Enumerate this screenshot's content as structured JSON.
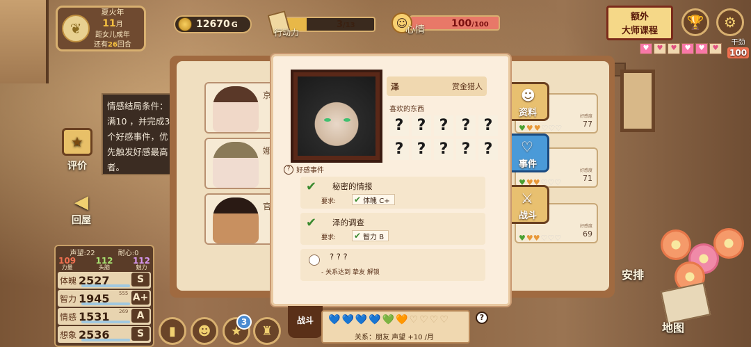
{
  "date": {
    "season": "夏火年",
    "month_num": "11",
    "month_unit": "月",
    "countdown_prefix": "距女儿成年",
    "countdown_mid": "还有",
    "countdown_turns": "26",
    "countdown_suffix": "回合"
  },
  "gold": {
    "value": "12670",
    "unit": "G"
  },
  "action_points": {
    "label": "行动力",
    "current": "3",
    "max": "/13",
    "fraction": 0.23
  },
  "mood": {
    "label": "心情",
    "current": "100",
    "max": "/100"
  },
  "course_button": {
    "line1": "额外",
    "line2": "大师课程"
  },
  "top_hearts": [
    "♥",
    "♥",
    "♥",
    "♥",
    "♥",
    "♥"
  ],
  "dry": {
    "label": "干劲",
    "value": "100"
  },
  "tooltip": {
    "text": "情感结局条件：满10  ，并完成3个好感事件，优先触发好感最高者。"
  },
  "left_buttons": {
    "evaluate": "评价",
    "back": "回屋"
  },
  "stats": {
    "reputation": "声望:22",
    "patience": "耐心:0",
    "resources": [
      {
        "value": "109",
        "label": "力量"
      },
      {
        "value": "112",
        "label": "头脑"
      },
      {
        "value": "112",
        "label": "魅力"
      }
    ],
    "rows": [
      {
        "name": "体魄",
        "value": "2527",
        "sub": "",
        "grade": "S"
      },
      {
        "name": "智力",
        "value": "1945",
        "sub": "555",
        "grade": "A+"
      },
      {
        "name": "情感",
        "value": "1531",
        "sub": "269",
        "grade": "A"
      },
      {
        "name": "想象",
        "value": "2536",
        "sub": "",
        "grade": "S"
      }
    ]
  },
  "bottom_buttons": {
    "badge_count": "3"
  },
  "characters": [
    {
      "name": "京"
    },
    {
      "name": "娜"
    },
    {
      "name": "官"
    }
  ],
  "affection_cards": [
    {
      "sub": "好感度",
      "value": "77"
    },
    {
      "sub": "好感度",
      "value": "71"
    },
    {
      "sub": "好感度",
      "value": "69"
    }
  ],
  "side_tabs": {
    "profile": "资料",
    "events": "事件",
    "battle": "战斗"
  },
  "modal": {
    "name": "泽",
    "role": "赏金猎人",
    "likes_title": "喜欢的东西",
    "likes": [
      "?",
      "?",
      "?",
      "?",
      "?",
      "?",
      "?",
      "?",
      "?",
      "?"
    ],
    "events_title": "好感事件",
    "events": [
      {
        "title": "秘密的情报",
        "req_label": "要求:",
        "req": "体魄 C+"
      },
      {
        "title": "泽的调查",
        "req_label": "要求:",
        "req": "智力 B"
      }
    ],
    "locked_event": {
      "title": "? ? ?",
      "note": "- 关系达到 挚友 解锁"
    }
  },
  "relation": {
    "fight_tab": "战斗",
    "hearts": [
      "💙",
      "💙",
      "💙",
      "💙",
      "💚",
      "🧡",
      "♡",
      "♡",
      "♡",
      "♡"
    ],
    "text": "关系：朋友   声望 +10 /月"
  },
  "right_buttons": {
    "arrange": "安排",
    "map": "地图"
  },
  "colors": {
    "accent_gold": "#d8b070",
    "panel_dark": "#3b2c22",
    "event_blue": "#4a9ad8"
  }
}
